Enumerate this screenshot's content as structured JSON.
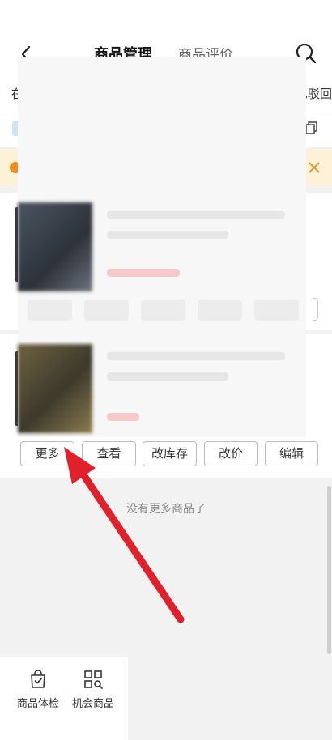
{
  "header": {
    "tab_active": "商品管理",
    "tab_inactive": "商品评价"
  },
  "subtabs": {
    "first": "在",
    "last": "已驳回"
  },
  "card_actions": {
    "more": "更多",
    "view": "查看",
    "edit_stock": "改库存",
    "edit_price": "改价",
    "edit": "编辑"
  },
  "list_end": "没有更多商品了",
  "bottom_bar": {
    "items": [
      {
        "label": "商品体检",
        "icon": "bag-check-icon"
      },
      {
        "label": "机会商品",
        "icon": "grid-search-icon"
      }
    ]
  },
  "colors": {
    "notice_bg": "#fdf1d8",
    "notice_accent": "#f08c20",
    "arrow": "#e0202a"
  }
}
